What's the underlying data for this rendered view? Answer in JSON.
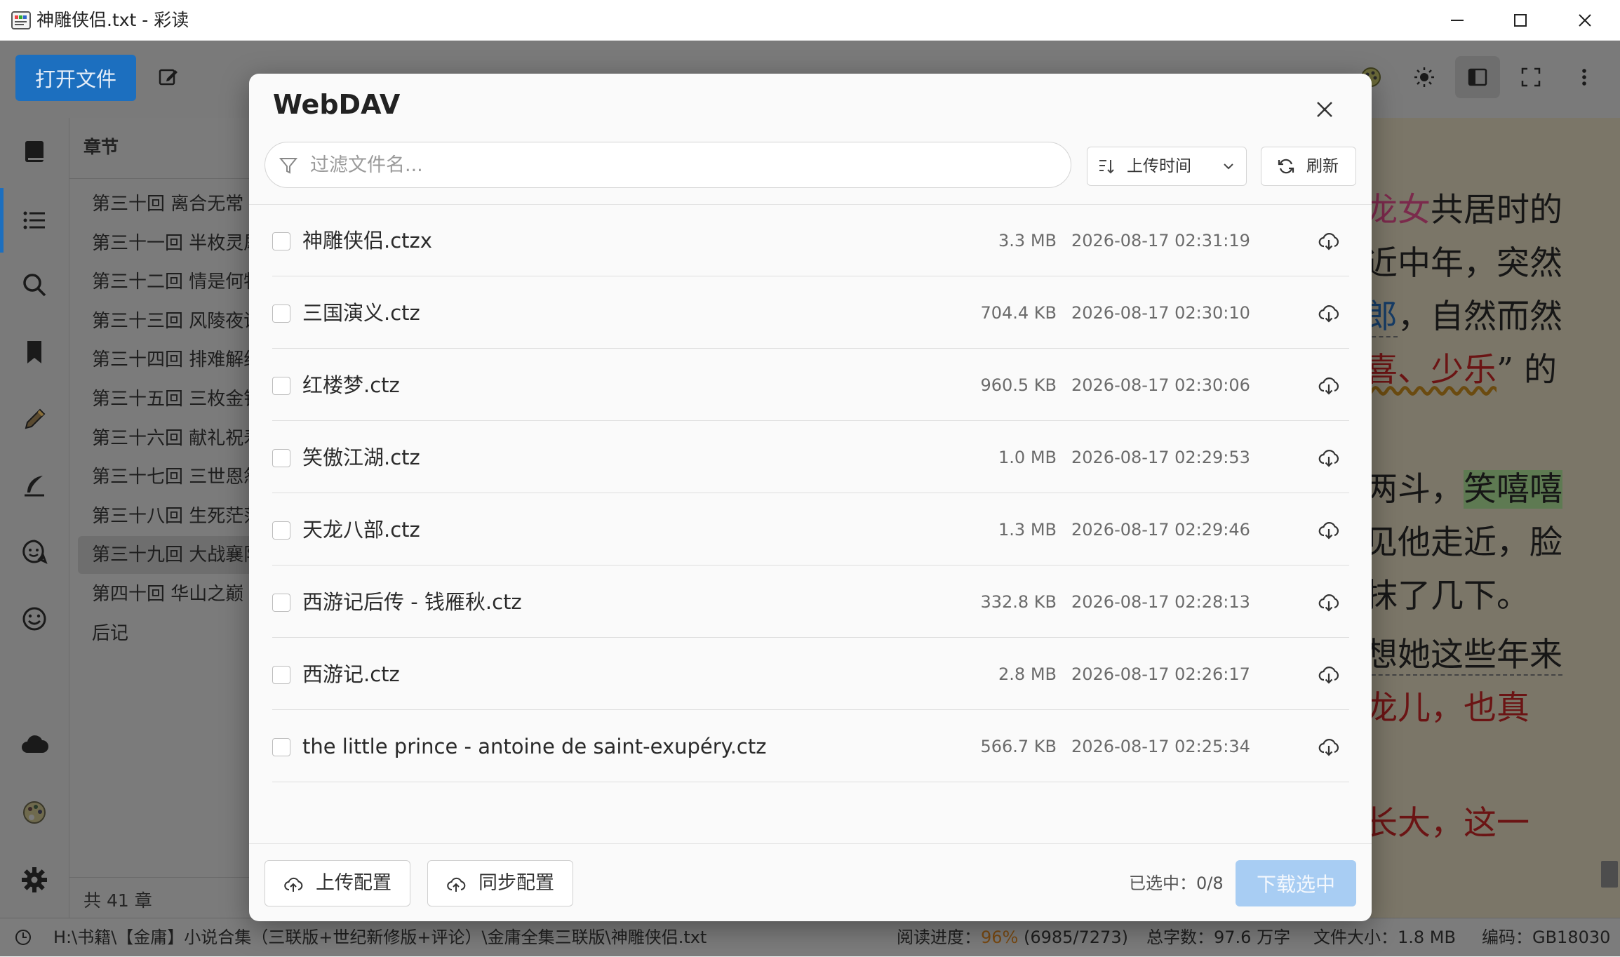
{
  "window": {
    "title": "神雕侠侣.txt - 彩读"
  },
  "toolbar": {
    "open_file_label": "打开文件"
  },
  "chapter_panel": {
    "header": "章节",
    "items": [
      "第三十回 离合无常",
      "第三十一回 半枚灵犀",
      "第三十二回 情是何物",
      "第三十三回 风陵夜话",
      "第三十四回 排难解纷",
      "第三十五回 三枚金针",
      "第三十六回 献礼祝寿",
      "第三十七回 三世恩怨",
      "第三十八回 生死茫茫",
      "第三十九回 大战襄阳",
      "第四十回 华山之巅",
      "后记"
    ],
    "active_index": 9,
    "count_label": "共 41 章"
  },
  "reader": {
    "lines": [
      {
        "a": "",
        "b": "龙女",
        "c": "共居时的"
      },
      {
        "a": "",
        "b": "",
        "c": "近中年，突然"
      },
      {
        "a": "",
        "b": "郎",
        "c": "，自然而然"
      },
      {
        "a": "",
        "b": "喜、少乐",
        "c": "” 的"
      },
      {
        "a": "",
        "b": "",
        "c": "两斗，"
      },
      {
        "a": "",
        "b": "",
        "c": "见他走近，脸"
      },
      {
        "a": "",
        "b": "",
        "c": "抹了几下。"
      },
      {
        "a": "",
        "b": "",
        "c": "想她这些年来"
      },
      {
        "a": "",
        "b": "",
        "c": "龙儿，也真"
      },
      {
        "a": "",
        "b": "",
        "c": "长大，这一"
      }
    ],
    "highlight_word": "笑嘻嘻"
  },
  "status": {
    "path": "H:\\书籍\\【金庸】小说合集（三联版+世纪新修版+评论）\\金庸全集三联版\\神雕侠侣.txt",
    "progress_label": "阅读进度：",
    "progress_percent": "96%",
    "progress_detail": "(6985/7273)",
    "word_count": "总字数：97.6 万字",
    "file_size": "文件大小：1.8 MB",
    "encoding": "编码：GB18030"
  },
  "dialog": {
    "title": "WebDAV",
    "filter_placeholder": "过滤文件名...",
    "sort_label": "上传时间",
    "refresh_label": "刷新",
    "files": [
      {
        "name": "神雕侠侣.ctzx",
        "size": "3.3 MB",
        "time": "2026-08-17 02:31:19"
      },
      {
        "name": "三国演义.ctz",
        "size": "704.4 KB",
        "time": "2026-08-17 02:30:10"
      },
      {
        "name": "红楼梦.ctz",
        "size": "960.5 KB",
        "time": "2026-08-17 02:30:06"
      },
      {
        "name": "笑傲江湖.ctz",
        "size": "1.0 MB",
        "time": "2026-08-17 02:29:53"
      },
      {
        "name": "天龙八部.ctz",
        "size": "1.3 MB",
        "time": "2026-08-17 02:29:46"
      },
      {
        "name": "西游记后传 - 钱雁秋.ctz",
        "size": "332.8 KB",
        "time": "2026-08-17 02:28:13"
      },
      {
        "name": "西游记.ctz",
        "size": "2.8 MB",
        "time": "2026-08-17 02:26:17"
      },
      {
        "name": "the little prince - antoine de saint-exupéry.ctz",
        "size": "566.7 KB",
        "time": "2026-08-17 02:25:34"
      }
    ],
    "upload_config_label": "上传配置",
    "sync_config_label": "同步配置",
    "selected_label": "已选中：0/8",
    "download_selected_label": "下载选中"
  },
  "colors": {
    "primary": "#1c6fbf",
    "primary_disabled": "#a8cdf3",
    "progress_accent": "#e08a1e"
  }
}
